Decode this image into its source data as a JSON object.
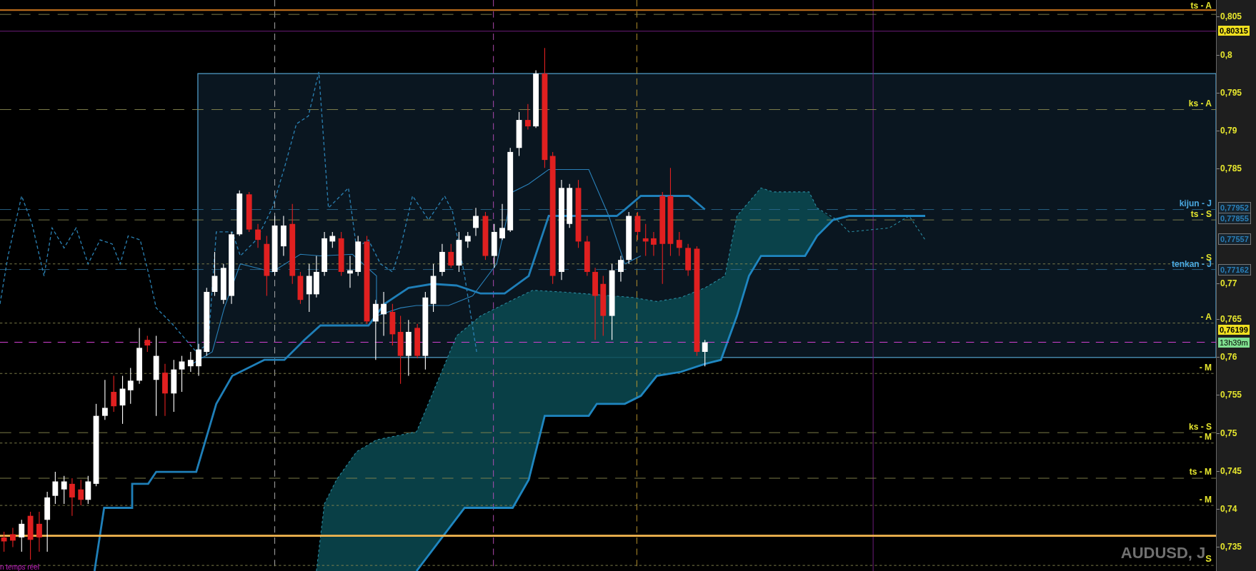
{
  "chart": {
    "symbol": "AUDUSD, J$_{S}$",
    "status": "n temps réel",
    "price_axis": {
      "ticks": [
        "0,805",
        "0,8",
        "0,795",
        "0,79",
        "0,785",
        "0,77",
        "0,765",
        "0,76",
        "0,755",
        "0,75",
        "0,745",
        "0,74",
        "0,735"
      ]
    },
    "price_tags": [
      {
        "kind": "highlight",
        "text": "0,80315"
      },
      {
        "kind": "boxed",
        "text": "0,77952"
      },
      {
        "kind": "boxed",
        "text": "0,77855"
      },
      {
        "kind": "boxed",
        "text": "0,77557"
      },
      {
        "kind": "boxed",
        "text": "0,77162"
      },
      {
        "kind": "highlight",
        "text": "0,76199"
      },
      {
        "kind": "timer",
        "text": "13h39m"
      }
    ],
    "level_labels": [
      {
        "text": "ts - A",
        "color": "#e6e62e"
      },
      {
        "text": "ks - A",
        "color": "#e6e62e"
      },
      {
        "text": "kijun - J",
        "color": "#4aa8e0"
      },
      {
        "text": "ts - S",
        "color": "#e6e62e"
      },
      {
        "text": "- S",
        "color": "#e6e62e"
      },
      {
        "text": "tenkan - J",
        "color": "#4aa8e0"
      },
      {
        "text": "- A",
        "color": "#e6e62e"
      },
      {
        "text": "- M",
        "color": "#e6e62e"
      },
      {
        "text": "ks - S",
        "color": "#e6e62e"
      },
      {
        "text": "- M",
        "color": "#e6e62e"
      },
      {
        "text": "ts - M",
        "color": "#e6e62e"
      },
      {
        "text": "- M",
        "color": "#e6e62e"
      }
    ]
  }
}
